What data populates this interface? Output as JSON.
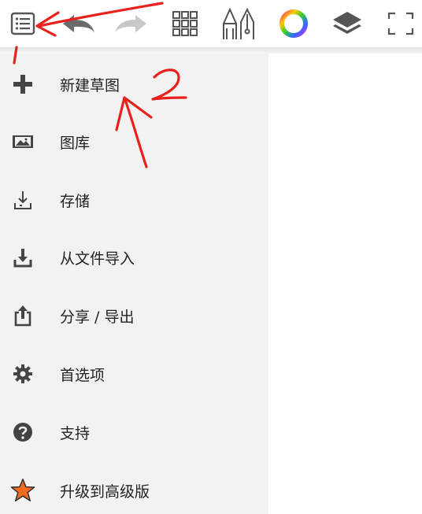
{
  "toolbar": {
    "buttons": [
      {
        "name": "menu-list-icon"
      },
      {
        "name": "undo-icon"
      },
      {
        "name": "redo-icon"
      },
      {
        "name": "grid-icon"
      },
      {
        "name": "brush-tools-icon"
      },
      {
        "name": "color-wheel-icon"
      },
      {
        "name": "layers-icon"
      },
      {
        "name": "fullscreen-icon"
      }
    ]
  },
  "menu": {
    "items": [
      {
        "label": "新建草图",
        "icon": "plus-icon"
      },
      {
        "label": "图库",
        "icon": "gallery-icon"
      },
      {
        "label": "存储",
        "icon": "save-icon"
      },
      {
        "label": "从文件导入",
        "icon": "import-icon"
      },
      {
        "label": "分享 / 导出",
        "icon": "share-icon"
      },
      {
        "label": "首选项",
        "icon": "gear-icon"
      },
      {
        "label": "支持",
        "icon": "help-icon"
      },
      {
        "label": "升级到高级版",
        "icon": "star-icon"
      }
    ]
  },
  "annotations": {
    "number_one": "1",
    "number_two": "2"
  },
  "colors": {
    "annotation": "#e8211d",
    "menu_bg": "#f2f2f2",
    "icon": "#444444",
    "star": "#f26a21"
  }
}
